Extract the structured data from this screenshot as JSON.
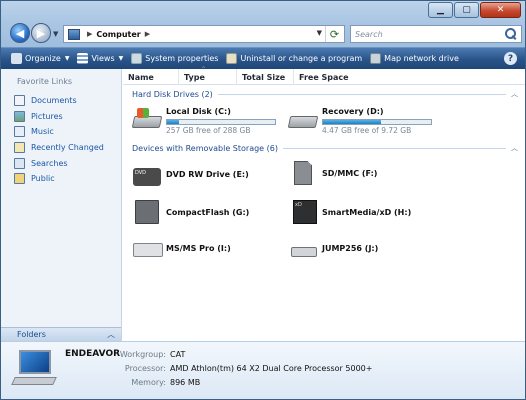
{
  "address_bar": {
    "path": [
      "Computer"
    ],
    "search_placeholder": "Search"
  },
  "toolbar": {
    "items": [
      {
        "label": "Organize",
        "has_menu": true
      },
      {
        "label": "Views",
        "has_menu": true
      },
      {
        "label": "System properties"
      },
      {
        "label": "Uninstall or change a program"
      },
      {
        "label": "Map network drive"
      }
    ]
  },
  "nav_pane": {
    "heading": "Favorite Links",
    "links": [
      "Documents",
      "Pictures",
      "Music",
      "Recently Changed",
      "Searches",
      "Public"
    ],
    "folders_label": "Folders"
  },
  "columns": [
    "Name",
    "Type",
    "Total Size",
    "Free Space"
  ],
  "groups": [
    {
      "title": "Hard Disk Drives (2)",
      "items": [
        {
          "name": "Local Disk (C:)",
          "free_text": "257 GB free of 288 GB",
          "used_fraction": 0.11
        },
        {
          "name": "Recovery (D:)",
          "free_text": "4.47 GB free of 9.72 GB",
          "used_fraction": 0.54
        }
      ]
    },
    {
      "title": "Devices with Removable Storage (6)",
      "items": [
        {
          "name": "DVD RW Drive (E:)",
          "icon": "dvd-drive-icon"
        },
        {
          "name": "SD/MMC (F:)",
          "icon": "sd-card-icon"
        },
        {
          "name": "CompactFlash (G:)",
          "icon": "compactflash-icon"
        },
        {
          "name": "SmartMedia/xD (H:)",
          "icon": "smartmedia-icon"
        },
        {
          "name": "MS/MS Pro (I:)",
          "icon": "memory-stick-icon"
        },
        {
          "name": "JUMP256 (J:)",
          "icon": "usb-drive-icon"
        }
      ]
    }
  ],
  "details": {
    "computer_name": "ENDEAVOR",
    "fields": [
      {
        "label": "Workgroup:",
        "value": "CAT"
      },
      {
        "label": "Processor:",
        "value": "AMD Athlon(tm) 64 X2 Dual Core Processor 5000+"
      },
      {
        "label": "Memory:",
        "value": "896 MB"
      }
    ]
  },
  "colors": {
    "link": "#1b57a6",
    "group_header": "#1d4a90",
    "toolbar": "#29548a",
    "drive_fill": "#1f7fc1"
  }
}
